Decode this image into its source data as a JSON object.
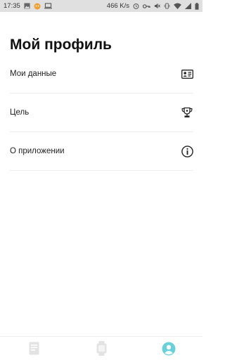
{
  "status_bar": {
    "time": "17:35",
    "network_speed": "466 K/s",
    "left_icons": [
      "gallery-icon",
      "notification-icon",
      "laptop-icon"
    ],
    "right_icons": [
      "alarm-icon",
      "key-icon",
      "mute-icon",
      "vibrate-icon",
      "wifi-icon",
      "signal-icon",
      "battery-icon"
    ]
  },
  "page": {
    "title": "Мой профиль"
  },
  "menu": {
    "items": [
      {
        "label": "Мои данные",
        "icon": "id-card-icon"
      },
      {
        "label": "Цель",
        "icon": "trophy-icon"
      },
      {
        "label": "О приложении",
        "icon": "info-icon"
      }
    ]
  },
  "bottom_nav": {
    "tabs": [
      {
        "icon": "document-icon",
        "active": false
      },
      {
        "icon": "watch-icon",
        "active": false
      },
      {
        "icon": "profile-icon",
        "active": true
      }
    ],
    "inactive_color": "#e3e3e3",
    "active_color": "#6ad0da"
  }
}
